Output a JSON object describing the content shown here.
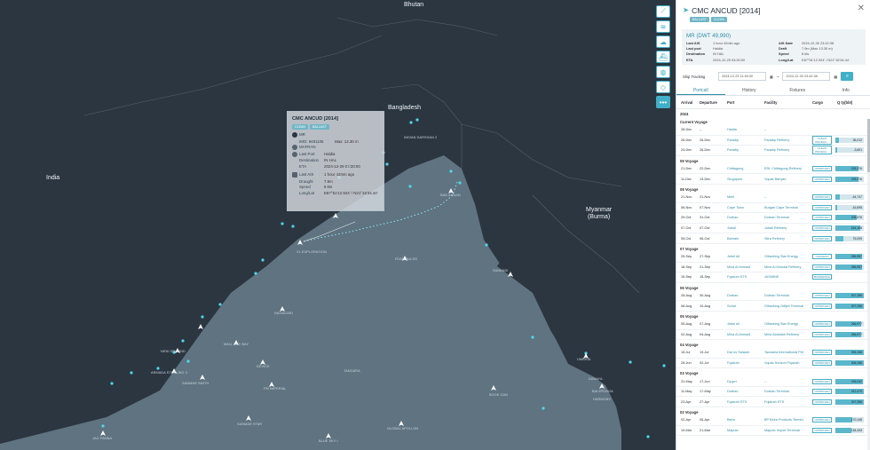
{
  "map": {
    "countries": [
      {
        "id": "bhutan",
        "name": "Bhutan"
      },
      {
        "id": "bangladesh",
        "name": "Bangladesh"
      },
      {
        "id": "india",
        "name": "India"
      },
      {
        "id": "myanmar",
        "name": "Myanmar\n(Burma)"
      }
    ],
    "vessels": [
      "INDIAN DARSHAN 2",
      "BAN ANNAN",
      "V1 EXPLORATION",
      "FDAN BULDS",
      "SANANDI",
      "MALL DEY BAY",
      "DEVICE",
      "NAGAGARI",
      "SANMAR SMITH",
      "PM IMPERIAL",
      "ARMADA STERLING 3",
      "NEW GROUND",
      "TANGARA",
      "SANMAR STAR",
      "GLOBAL APOLLON",
      "BLUE SKY I",
      "JAG PANNA",
      "BOOK GAN",
      "UMBRIA",
      "HARMONY",
      "BIA 5PONGA",
      "DANAYA"
    ]
  },
  "popup": {
    "title": "CMC ANCUD [2014]",
    "tags": [
      "CLEAN",
      "BALLAST"
    ],
    "rows": [
      {
        "k": "MR",
        "v": ""
      },
      {
        "k": "IMO: 9481106",
        "v": "Max: 13.30 m"
      },
      {
        "k": "MAFRAN",
        "v": ""
      },
      {
        "k": "Last Port",
        "v": "Haldia"
      },
      {
        "k": "Destination",
        "v": "IN HAL"
      },
      {
        "k": "ETA",
        "v": "2024-12-29 03:30:00"
      },
      {
        "k": "Last AIS",
        "v": "1 hour 42min ago"
      },
      {
        "k": "Draught",
        "v": "7.9m"
      },
      {
        "k": "Speed",
        "v": "6 kts"
      },
      {
        "k": "Long/Lat",
        "v": "E87°51'12.924' / N21°16'34.44'"
      }
    ]
  },
  "tools": [
    "route-icon",
    "layers-icon",
    "weather-icon",
    "ship-icon",
    "globe-icon",
    "eraser-icon",
    "more-icon"
  ],
  "panel": {
    "title": "CMC ANCUD [2014]",
    "badges": [
      "BALLAST",
      "CLEAN"
    ],
    "close": "✕",
    "class_line": "MR (DWT 49,990)",
    "info": [
      {
        "k": "Last AIS",
        "v": "1 hour 42min ago",
        "k2": "AIS Date",
        "v2": "2024-12-30 23:42:38"
      },
      {
        "k": "Last port",
        "v": "Haldia",
        "k2": "Draft",
        "v2": "7.9m (Max 13.30 m)"
      },
      {
        "k": "Destination",
        "v": "IN HAL",
        "k2": "Speed",
        "v2": "6 kts"
      },
      {
        "k": "ETA",
        "v": "2024-12-29 03:30:00",
        "k2": "Long/Lat",
        "v2": "E87°51'12.924' / N21°16'34.44'"
      }
    ],
    "tracking_label": "Ship Tracking",
    "date_from": "2024-12-23 11:45:30",
    "date_to": "2024-12-30 23:42:38",
    "tabs": [
      "Portcall",
      "History",
      "Fixtures",
      "Info"
    ],
    "columns": [
      "Arrival",
      "Departure",
      "Port",
      "Facility",
      "Cargo",
      "Q ty(bbl)"
    ],
    "year": "2024",
    "groups": [
      {
        "label": "Current Voyage",
        "rows": [
          {
            "a": "28-Dec",
            "d": "--",
            "p": "Haldia",
            "f": "--",
            "c": "",
            "q": "",
            "fill": 0
          },
          {
            "a": "26-Dec",
            "d": "26-Dec",
            "p": "Paradip",
            "f": "Paradip Refinery",
            "c": "CLEAN PRODUC...",
            "q": "36,212",
            "fill": 0.12
          },
          {
            "a": "24-Dec",
            "d": "26-Dec",
            "p": "Paradip",
            "f": "Paradip Refinery",
            "c": "CLEAN PRODUC...",
            "q": "-3,601",
            "fill": 0.05
          }
        ]
      },
      {
        "label": "09 Voyage",
        "rows": [
          {
            "a": "21-Dec",
            "d": "22-Dec",
            "p": "Chittagong",
            "f": "ERL Chittagong Refinery",
            "c": "OPPROVEN",
            "q": "228,376",
            "fill": 0.82
          },
          {
            "a": "11-Dec",
            "d": "13-Dec",
            "p": "Singapore",
            "f": "Vopak Banyan",
            "c": "OPPROVEN",
            "q": "228,376",
            "fill": 0.82
          }
        ]
      },
      {
        "label": "08 Voyage",
        "rows": [
          {
            "a": "21-Nov",
            "d": "21-Nov",
            "p": "Mele",
            "f": "--",
            "c": "OPPROVEN",
            "q": "-44,747",
            "fill": 0.16
          },
          {
            "a": "06-Nov",
            "d": "07-Nov",
            "p": "Cape Town",
            "f": "Burgan Cape Terminal",
            "c": "OPPROVEN",
            "q": "-16,695",
            "fill": 0.07
          },
          {
            "a": "29-Oct",
            "d": "31-Oct",
            "p": "Durban",
            "f": "Durban Terminal",
            "c": "OPPROVEN",
            "q": "208,676",
            "fill": 0.75
          },
          {
            "a": "07-Oct",
            "d": "07-Oct",
            "p": "Jubail",
            "f": "Jubail Refinery",
            "c": "OPPROVEN",
            "q": "244,108",
            "fill": 0.87
          },
          {
            "a": "05-Oct",
            "d": "06-Oct",
            "p": "Bahrain",
            "f": "Sitra Refinery",
            "c": "OPPROVEN",
            "q": "76,009",
            "fill": 0.28
          }
        ]
      },
      {
        "label": "07 Voyage",
        "rows": [
          {
            "a": "25-Sep",
            "d": "27-Sep",
            "p": "Jebel Ali",
            "f": "Oiltanking Star Energy",
            "c": "CRUDESS",
            "q": "286,987",
            "fill": 0.95
          },
          {
            "a": "18-Sep",
            "d": "21-Sep",
            "p": "Mina Al Ahmadi",
            "f": "Mina Al Ahmadi Refinery",
            "c": "OPPROVEN",
            "q": "286,987",
            "fill": 0.95
          },
          {
            "a": "15-Sep",
            "d": "15-Sep",
            "p": "Fujairah STS",
            "f": "JASMINE",
            "c": "BUNKERING",
            "q": "",
            "fill": 0
          }
        ]
      },
      {
        "label": "06 Voyage",
        "rows": [
          {
            "a": "28-Aug",
            "d": "30-Aug",
            "p": "Durban",
            "f": "Durban Terminal",
            "c": "OPPROVEN",
            "q": "307,286",
            "fill": 1
          },
          {
            "a": "08-Aug",
            "d": "10-Aug",
            "p": "Sohar",
            "f": "Oiltanking Odfjell Terminal O",
            "c": "OPPROVEN",
            "q": "307,286",
            "fill": 1
          }
        ]
      },
      {
        "label": "05 Voyage",
        "rows": [
          {
            "a": "05-Aug",
            "d": "07-Aug",
            "p": "Jebel Ali",
            "f": "Oiltanking Star Energy",
            "c": "OPPROVEN",
            "q": "266,977",
            "fill": 0.9
          },
          {
            "a": "02-Aug",
            "d": "04-Aug",
            "p": "Mina Al Ahmadi",
            "f": "Mina Abdullah Refinery",
            "c": "OPPROVEN",
            "q": "266,977",
            "fill": 0.9
          }
        ]
      },
      {
        "label": "04 Voyage",
        "rows": [
          {
            "a": "15-Jul",
            "d": "19-Jul",
            "p": "Dar es Salaam",
            "f": "Tanzania International Petrol...",
            "c": "OPPROVEN",
            "q": "306,158",
            "fill": 1
          },
          {
            "a": "28-Jun",
            "d": "02-Jul",
            "p": "Fujairah",
            "f": "Vopak Horizon Fujairah",
            "c": "OPPROVEN",
            "q": "306,158",
            "fill": 1
          }
        ]
      },
      {
        "label": "03 Voyage",
        "rows": [
          {
            "a": "31-May",
            "d": "17-Jun",
            "p": "Djupvi",
            "f": "--",
            "c": "OPPROVEN",
            "q": "296,042",
            "fill": 0.97
          },
          {
            "a": "11-May",
            "d": "17-May",
            "p": "Durban",
            "f": "Durban Terminal",
            "c": "OPPROVEN",
            "q": "312,470",
            "fill": 1
          },
          {
            "a": "23-Apr",
            "d": "27-Apr",
            "p": "Fujairah STS",
            "f": "Fujairah STS",
            "c": "OPPROVEN",
            "q": "307,286",
            "fill": 1
          }
        ]
      },
      {
        "label": "02 Voyage",
        "rows": [
          {
            "a": "02-Apr",
            "d": "05-Apr",
            "p": "Beira",
            "f": "BP Beira Products Terminal",
            "c": "OPPROVEN",
            "q": "170,148",
            "fill": 0.6
          },
          {
            "a": "19-Mar",
            "d": "21-Mar",
            "p": "Maputo",
            "f": "Maputo Import Terminal",
            "c": "OPPROVEN",
            "q": "154,433",
            "fill": 0.55
          }
        ]
      }
    ]
  }
}
